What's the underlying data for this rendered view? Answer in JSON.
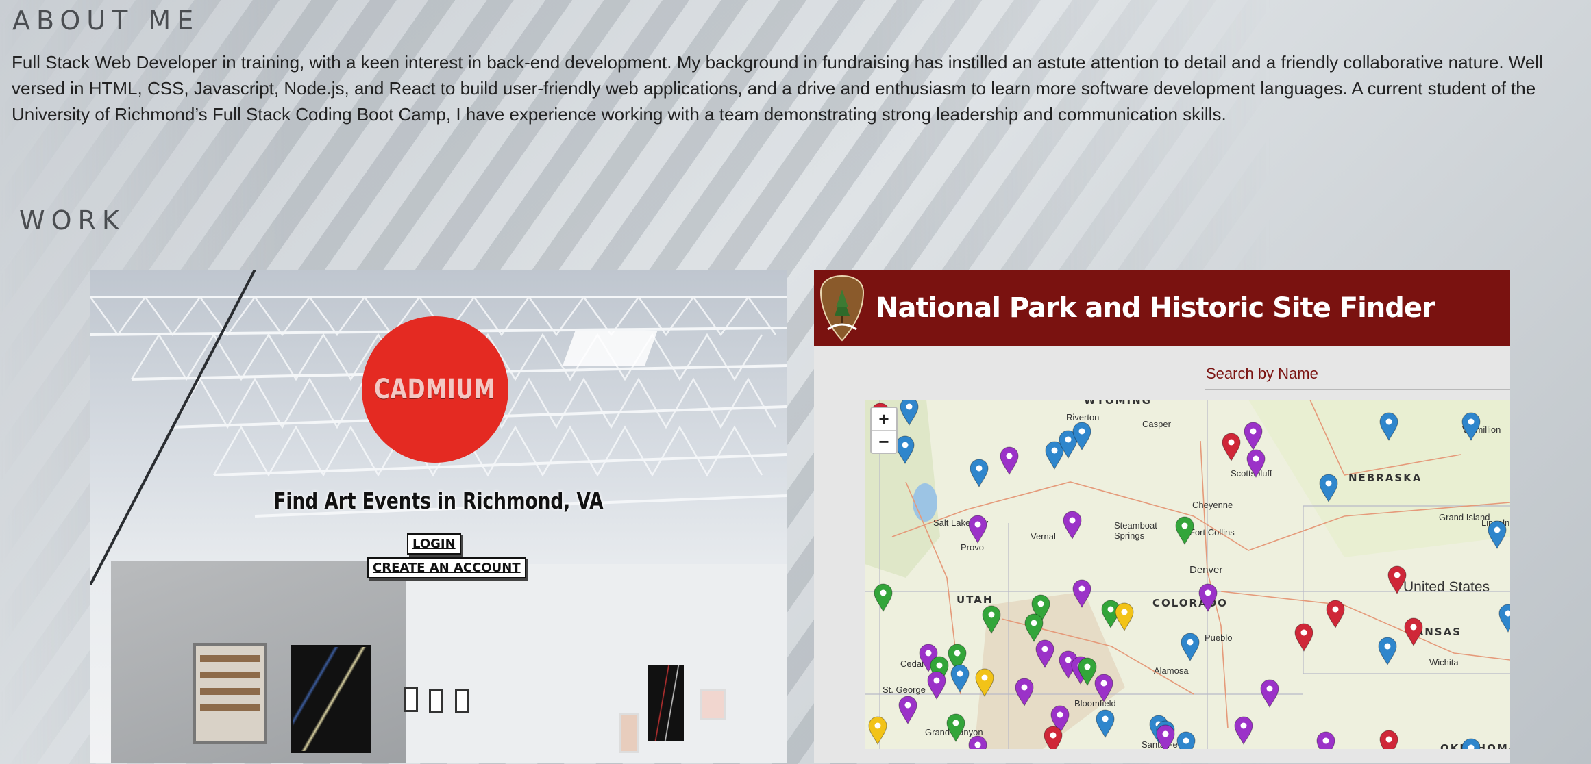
{
  "about": {
    "heading": "ABOUT ME",
    "text": "Full Stack Web Developer in training, with a keen interest in back-end development. My background in fundraising has instilled an astute attention to detail and a friendly collaborative nature. Well versed in HTML, CSS, Javascript, Node.js, and React to build user-friendly web applications, and a drive and enthusiasm to learn more software development languages. A current student of the University of Richmond’s Full Stack Coding Boot Camp, I have experience working with a team demonstrating strong leadership and communication skills."
  },
  "work": {
    "heading": "WORK",
    "cadmium": {
      "logo_text": "CADMIUM",
      "tagline": "Find Art Events in Richmond, VA",
      "login_label": "LOGIN",
      "create_label": "CREATE AN ACCOUNT"
    },
    "parks": {
      "title": "National Park and Historic Site Finder",
      "search_placeholder": "Search by Name",
      "zoom_in": "+",
      "zoom_out": "−",
      "country_label": "United States",
      "states": [
        "WYOMING",
        "NEBRASKA",
        "UTAH",
        "COLORADO",
        "KANSAS",
        "OKLAHOMA"
      ],
      "cities": [
        "Riverton",
        "Casper",
        "Scottsbluff",
        "Vermillion",
        "Salt Lake City",
        "Provo",
        "Vernal",
        "Steamboat Springs",
        "Cheyenne",
        "Fort Collins",
        "Grand Island",
        "Lincoln",
        "Denver",
        "Pueblo",
        "Cedar City",
        "St. George",
        "Alamosa",
        "Wichita",
        "Bloomfield",
        "Grand Canyon",
        "Santa Fe"
      ]
    }
  },
  "colors": {
    "park_header": "#7a1210",
    "cadmium_red": "#e42a22",
    "pin_blue": "#2f86cc",
    "pin_purple": "#9b32c8",
    "pin_green": "#33a53a",
    "pin_red": "#cf2738",
    "pin_yellow": "#f2c318"
  }
}
